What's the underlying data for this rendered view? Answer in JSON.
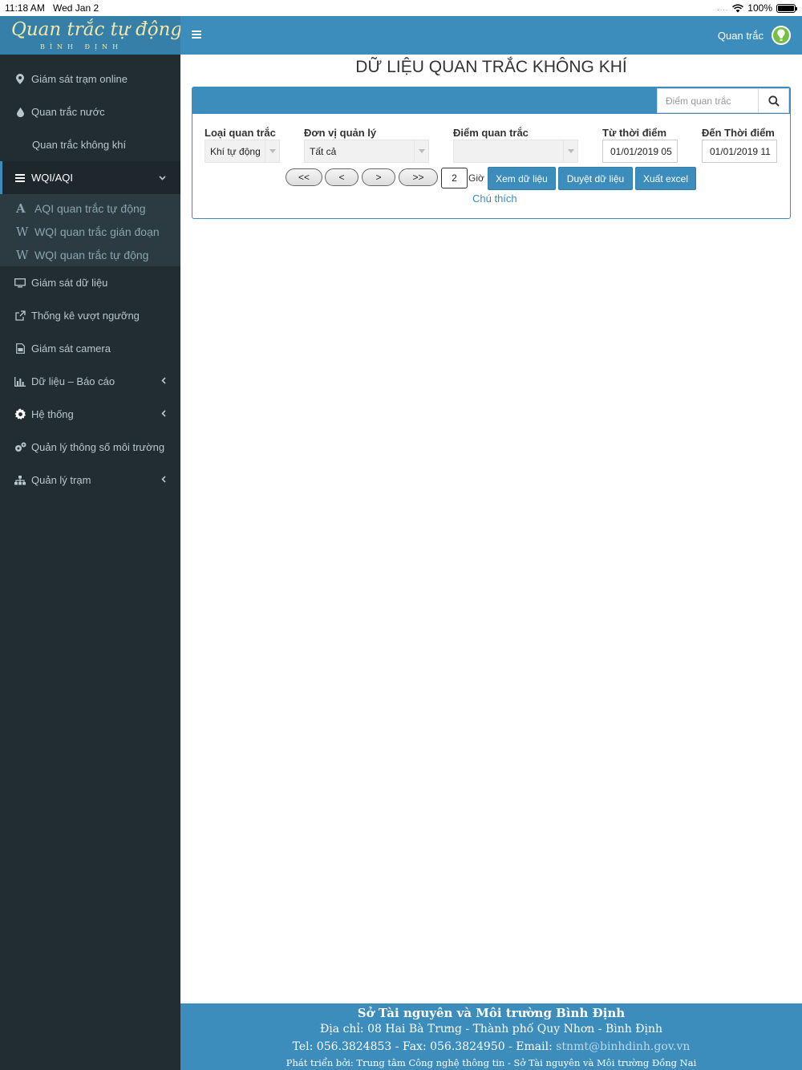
{
  "status_bar": {
    "time": "11:18 AM",
    "date": "Wed Jan 2",
    "battery": "100%",
    "signal_dots": "....",
    "battery_level": 1.0
  },
  "logo": {
    "title": "Quan trắc tự động",
    "subtitle": "BÌNH ĐỊNH"
  },
  "header": {
    "user_label": "Quan trắc"
  },
  "sidebar": {
    "items": [
      {
        "label": "Giám sát trạm online",
        "icon": "map-marker-icon"
      },
      {
        "label": "Quan trắc nước",
        "icon": "water-drop-icon"
      },
      {
        "label": "Quan trắc không khí",
        "icon": ""
      },
      {
        "label": "WQI/AQI",
        "icon": "list-icon"
      },
      {
        "label": "Giám sát dữ liệu",
        "icon": "monitor-icon"
      },
      {
        "label": "Thống kê vượt ngưỡng",
        "icon": "external-link-icon"
      },
      {
        "label": "Giám sát camera",
        "icon": "file-image-icon"
      },
      {
        "label": "Dữ liệu – Báo cáo",
        "icon": "bar-chart-icon"
      },
      {
        "label": "Hệ thống",
        "icon": "gear-icon"
      },
      {
        "label": "Quản lý thông số môi trường",
        "icon": "gears-icon"
      },
      {
        "label": "Quản lý trạm",
        "icon": "sitemap-icon"
      }
    ],
    "wqi_submenu": [
      {
        "letter": "A",
        "label": "AQI quan trắc tự động"
      },
      {
        "letter": "W",
        "label": "WQI quan trắc gián đoạn"
      },
      {
        "letter": "W",
        "label": "WQI quan trắc tự động"
      }
    ]
  },
  "main": {
    "title": "DỮ LIỆU QUAN TRẮC KHÔNG KHÍ",
    "search": {
      "placeholder": "Điểm quan trắc",
      "value": ""
    },
    "filters": {
      "type_label": "Loại quan trắc",
      "type_value": "Khí tự động",
      "unit_label": "Đơn vị quản lý",
      "unit_value": "Tất cả",
      "point_label": "Điểm quan trắc",
      "point_value": "",
      "from_label": "Từ thời điểm",
      "from_value": "01/01/2019 05",
      "to_label": "Đến Thời điểm",
      "to_value": "01/01/2019 11"
    },
    "nav": {
      "first": "<<",
      "prev": "<",
      "next": ">",
      "last": ">>"
    },
    "hours": {
      "value": "2",
      "unit": "Giờ"
    },
    "actions": {
      "view": "Xem dữ liệu",
      "approve": "Duyệt dữ liệu",
      "export": "Xuất excel"
    },
    "legend_link": "Chú thích"
  },
  "footer": {
    "org": "Sở Tài nguyên và Môi trường Bình Định",
    "address": "Địa chỉ: 08 Hai Bà Trưng - Thành phố Quy Nhơn - Bình Định",
    "contact": "Tel: 056.3824853 - Fax: 056.3824950 - Email:",
    "email": "stnmt@binhdinh.gov.vn",
    "developer": "Phát triển bởi: Trung tâm Công nghệ thông tin - Sở Tài nguyên và Môi trường Đồng Nai"
  },
  "colors": {
    "header": "#3c8dbc",
    "logo_bg": "#367fa9",
    "sidebar": "#222d32",
    "submenu": "#2c3b41",
    "link": "#3c8dbc"
  }
}
